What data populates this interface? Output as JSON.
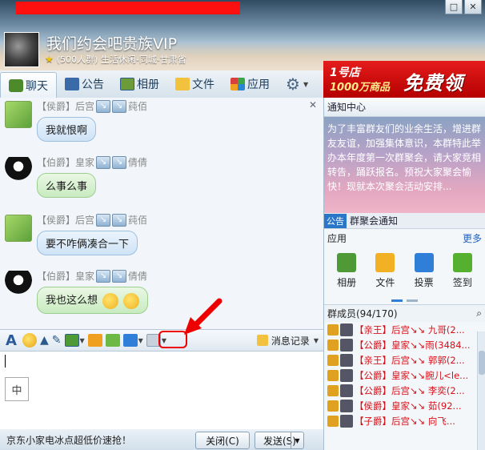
{
  "window": {
    "controls": [
      "□",
      "✕"
    ]
  },
  "group": {
    "name": "我们约会吧贵族VIP",
    "subtitle": "(500人群) 生活休闲-同城-甘肃省"
  },
  "tabs": [
    {
      "label": "聊天",
      "icon": "chat-icon"
    },
    {
      "label": "公告",
      "icon": "announcement-icon"
    },
    {
      "label": "相册",
      "icon": "album-icon"
    },
    {
      "label": "文件",
      "icon": "folder-icon"
    },
    {
      "label": "应用",
      "icon": "apps-icon"
    }
  ],
  "ad": {
    "store": "1号店",
    "goods": "1000万商品",
    "free": "免费领"
  },
  "chat": {
    "messages": [
      {
        "rank": "【侯爵】后宫",
        "name": "莼佰",
        "text": "我就恨啊",
        "avatar": "tiger",
        "style": "blue"
      },
      {
        "rank": "【伯爵】皇家",
        "name": "倩倩",
        "text": "么事么事",
        "avatar": "penguin",
        "style": "green"
      },
      {
        "rank": "【侯爵】后宫",
        "name": "莼佰",
        "text": "要不咋俩凑合一下",
        "avatar": "tiger",
        "style": "blue"
      },
      {
        "rank": "【伯爵】皇家",
        "name": "倩倩",
        "text": "我也这么想",
        "avatar": "penguin",
        "style": "green"
      }
    ]
  },
  "toolbar": {
    "font_label": "A",
    "history_label": "消息记录"
  },
  "input": {
    "ime_label": "中"
  },
  "bottom": {
    "promo": "京东小家电冰点超低价速抢！",
    "close_label": "关闭(C)",
    "send_label": "发送(S)"
  },
  "notice": {
    "header": "通知中心",
    "body": "为了丰富群友们的业余生活，增进群友友谊，加强集体意识，本群特此举办本年度第一次群聚会，请大家竞相转告，踊跃报名。预祝大家聚会愉快！现就本次聚会活动安排..."
  },
  "announcement": {
    "tag": "公告",
    "title": "群聚会通知"
  },
  "apps": {
    "header": "应用",
    "more": "更多",
    "items": [
      {
        "label": "相册",
        "icon": "album-icon"
      },
      {
        "label": "文件",
        "icon": "folder-icon"
      },
      {
        "label": "投票",
        "icon": "vote-icon"
      },
      {
        "label": "签到",
        "icon": "checkin-icon"
      }
    ]
  },
  "members": {
    "header": "群成员(94/170)",
    "list": [
      {
        "text": "【亲王】后宫↘↘ 九哥(2...",
        "suffix": ""
      },
      {
        "text": "【公爵】皇家↘↘雨(3484...",
        "suffix": ""
      },
      {
        "text": "【亲王】后宫↘↘ 郭郭(2...",
        "suffix": ""
      },
      {
        "text": "【公爵】皇家↘↘腕儿<le...",
        "suffix": ""
      },
      {
        "text": "【公爵】后宫↘↘ 李奕(2...",
        "suffix": ""
      },
      {
        "text": "【侯爵】皇家↘↘ 茹(92...",
        "suffix": ""
      },
      {
        "text": "【子爵】后宫↘↘ 向飞...",
        "suffix": ""
      }
    ]
  },
  "colors": {
    "accent": "#2f7ed8",
    "danger": "#e00000",
    "member_name": "#d8101a"
  }
}
